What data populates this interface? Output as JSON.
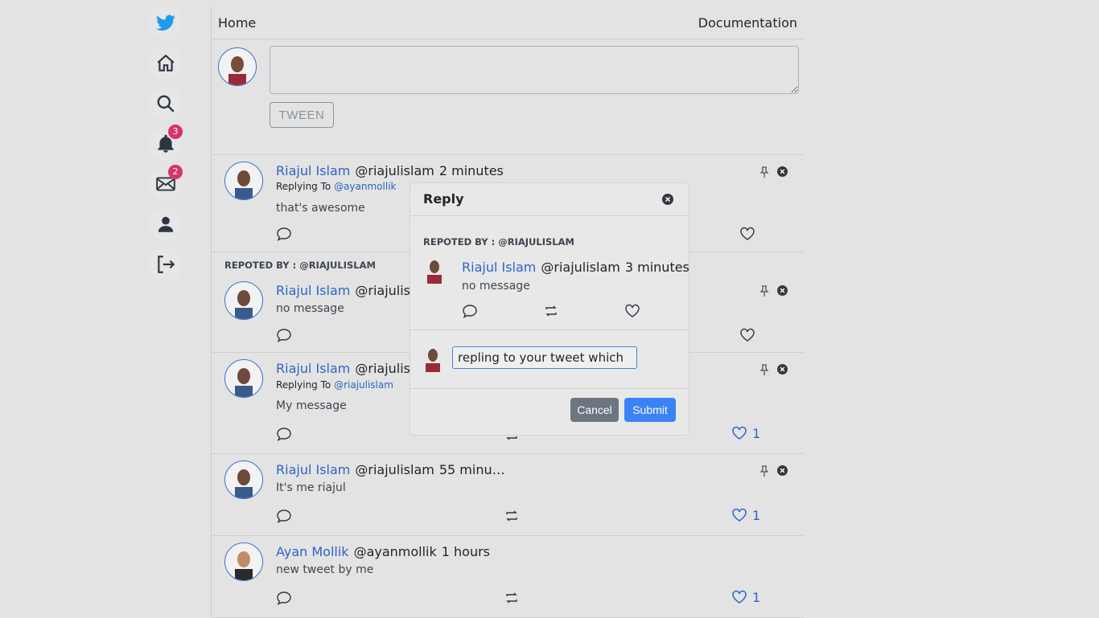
{
  "sidebar": {
    "items": [
      {
        "name": "twitter-logo",
        "icon": "twitter-bird-icon"
      },
      {
        "name": "home",
        "icon": "home-icon"
      },
      {
        "name": "search",
        "icon": "search-icon"
      },
      {
        "name": "notifications",
        "icon": "bell-icon",
        "badge": "3"
      },
      {
        "name": "messages",
        "icon": "mail-icon",
        "badge": "2"
      },
      {
        "name": "profile",
        "icon": "user-icon"
      },
      {
        "name": "logout",
        "icon": "logout-icon"
      }
    ]
  },
  "topbar": {
    "home_label": "Home",
    "docs_label": "Documentation"
  },
  "compose": {
    "button_label": "TWEEN"
  },
  "tweets": [
    {
      "repost_label": "",
      "name": "Riajul Islam",
      "handle": "@riajulislam",
      "time": "2 minutes",
      "replying_prefix": "Replying To",
      "replying_to": "@ayanmollik",
      "body": "that's awesome",
      "likes": ""
    },
    {
      "repost_label": "REPOTED BY : @RIAJULISLAM",
      "name": "Riajul Islam",
      "handle": "@riajulisla",
      "time": "",
      "replying_prefix": "",
      "replying_to": "",
      "body": "no message",
      "likes": ""
    },
    {
      "repost_label": "",
      "name": "Riajul Islam",
      "handle": "@riajulisla",
      "time": "",
      "replying_prefix": "Replying To",
      "replying_to": "@riajulislam",
      "body": "My message",
      "likes": "1"
    },
    {
      "repost_label": "",
      "name": "Riajul Islam",
      "handle": "@riajulislam",
      "time": "55 minu…",
      "replying_prefix": "",
      "replying_to": "",
      "body": "It's me riajul",
      "likes": "1"
    },
    {
      "repost_label": "",
      "name": "Ayan Mollik",
      "handle": "@ayanmollik",
      "time": "1 hours",
      "replying_prefix": "",
      "replying_to": "",
      "body": "new tweet by me",
      "likes": "1"
    }
  ],
  "modal": {
    "title": "Reply",
    "repost_label": "REPOTED BY : @RIAJULISLAM",
    "name": "Riajul Islam",
    "handle": "@riajulislam",
    "time": "3 minutes",
    "body": "no message",
    "reply_value": "repling to your tweet which",
    "cancel_label": "Cancel",
    "submit_label": "Submit"
  },
  "colors": {
    "accent": "#2c64c6",
    "badge": "#d6336c",
    "submit": "#3b82f6",
    "cancel": "#6c7680"
  }
}
